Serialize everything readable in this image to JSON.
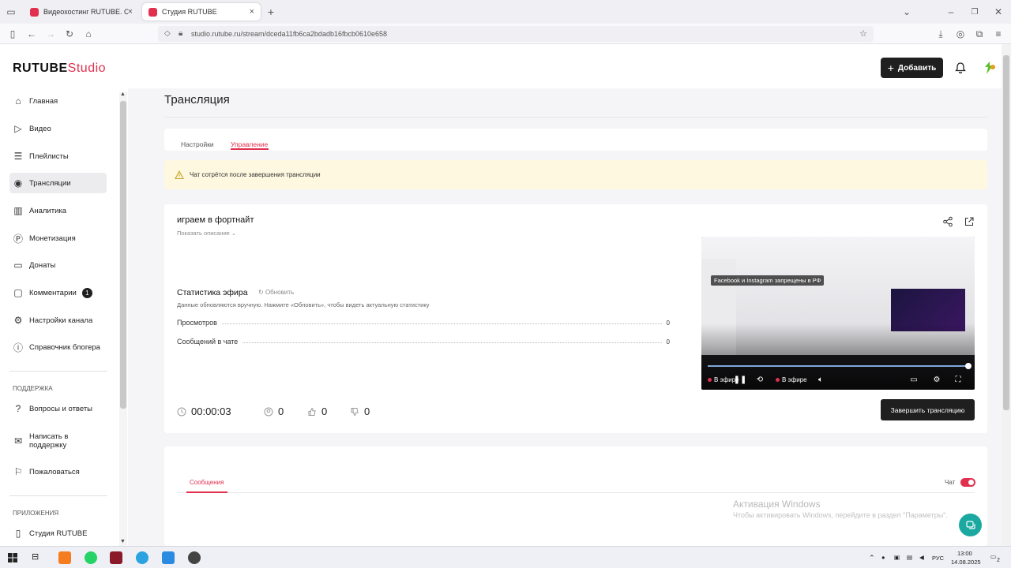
{
  "browser": {
    "tabs": [
      {
        "title": "Видеохостинг RUTUBE. Смотр"
      },
      {
        "title": "Студия RUTUBE"
      }
    ],
    "new_tab": "+",
    "url": "studio.rutube.ru/stream/dceda11fb6ca2bdadb16fbcb0610e658"
  },
  "header": {
    "logo_main": "RUTUBE",
    "logo_studio": "Studio",
    "add_label": "Добавить"
  },
  "sidebar": {
    "items": [
      {
        "label": "Главная"
      },
      {
        "label": "Видео"
      },
      {
        "label": "Плейлисты"
      },
      {
        "label": "Трансляции"
      },
      {
        "label": "Аналитика"
      },
      {
        "label": "Монетизация"
      },
      {
        "label": "Донаты"
      },
      {
        "label": "Комментарии",
        "badge": "1"
      },
      {
        "label": "Настройки канала"
      },
      {
        "label": "Справочник блогера"
      }
    ],
    "support_heading": "ПОДДЕРЖКА",
    "support_items": [
      {
        "label": "Вопросы и ответы"
      },
      {
        "label": "Написать в поддержку"
      },
      {
        "label": "Пожаловаться"
      }
    ],
    "apps_heading": "ПРИЛОЖЕНИЯ",
    "apps_items": [
      {
        "label": "Студия RUTUBE"
      }
    ]
  },
  "page": {
    "title": "Трансляция",
    "tabs": [
      {
        "label": "Настройки"
      },
      {
        "label": "Управление"
      }
    ],
    "warning": "Чат сотрётся после завершения трансляции"
  },
  "stream": {
    "title": "играем в фортнайт",
    "show_description": "Показать описание",
    "stats_title": "Статистика эфира",
    "refresh_label": "Обновить",
    "stats_note": "Данные обновляются вручную. Нажмите «Обновить», чтобы видеть актуальную статистику",
    "stats": [
      {
        "label": "Просмотров",
        "value": "0"
      },
      {
        "label": "Сообщений в чате",
        "value": "0"
      }
    ],
    "duration": "00:00:03",
    "viewers": "0",
    "likes": "0",
    "dislikes": "0",
    "end_label": "Завершить трансляцию",
    "video": {
      "overlay_tag": "Facebook и Instagram запрещены в РФ",
      "live_left": "В эфире",
      "live_right": "В эфире",
      "progress": 1.0
    }
  },
  "chat": {
    "messages_tab": "Сообщения",
    "chat_label": "Чат",
    "enabled": true
  },
  "watermark": {
    "line1": "Активация Windows",
    "line2": "Чтобы активировать Windows, перейдите в раздел \"Параметры\"."
  },
  "taskbar": {
    "lang": "РУС",
    "time": "13:00",
    "date": "14.08.2025",
    "notifications": "2"
  },
  "colors": {
    "accent": "#e0304e",
    "dark_button": "#1f1f1f",
    "warning_bg": "#fdf8df",
    "help": "#1aa8a0"
  }
}
